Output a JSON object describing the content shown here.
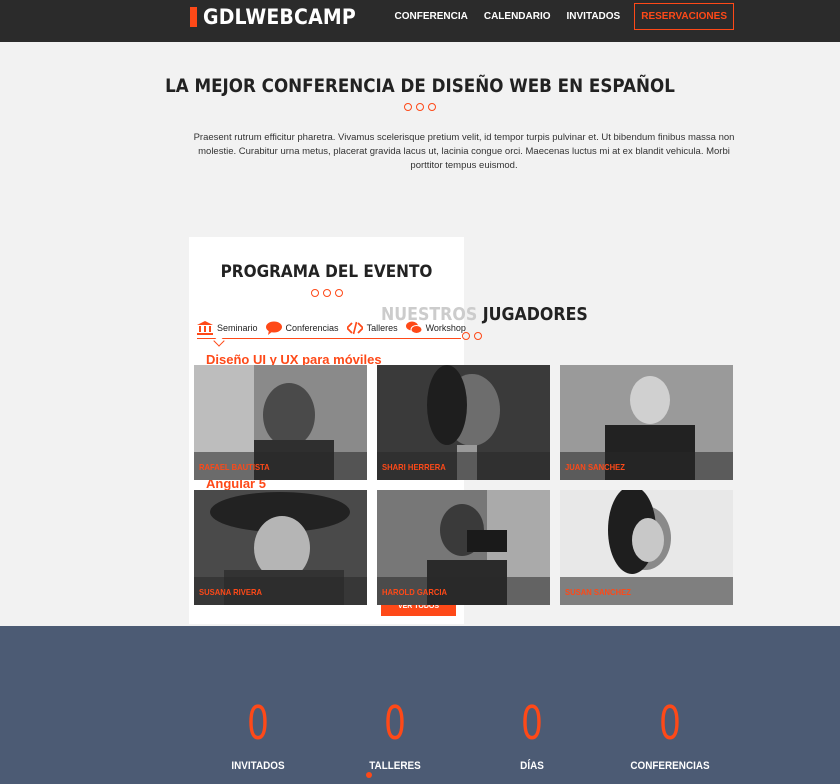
{
  "header": {
    "logo": "GDLWEBCAMP",
    "nav": [
      "CONFERENCIA",
      "CALENDARIO",
      "INVITADOS"
    ],
    "cta": "RESERVACIONES"
  },
  "intro": {
    "title": "LA MEJOR CONFERENCIA DE DISEÑO WEB EN ESPAÑOL",
    "text": "Praesent rutrum efficitur pharetra. Vivamus scelerisque pretium velit, id tempor turpis pulvinar et. Ut bibendum finibus massa non molestie. Curabitur urna metus, placerat gravida lacus ut, lacinia congue orci. Maecenas luctus mi at ex blandit vehicula. Morbi porttitor tempus euismod."
  },
  "program": {
    "title": "PROGRAMA DEL EVENTO",
    "tabs": [
      "Seminario",
      "Conferencias",
      "Talleres",
      "Workshop"
    ],
    "events": [
      "Diseño UI y UX para móviles",
      "Angular 5"
    ],
    "button": "VER TODOS"
  },
  "players": {
    "title_ghost": "NUESTROS",
    "title_rest": " JUGADORES",
    "names": [
      "RAFAEL BAUTISTA",
      "SHARI HERRERA",
      "JUAN SANCHEZ",
      "SUSANA RIVERA",
      "HAROLD GARCIA",
      "SUSAN SANCHEZ"
    ]
  },
  "stats": {
    "items": [
      {
        "value": "0",
        "label": "INVITADOS"
      },
      {
        "value": "0",
        "label": "TALLERES"
      },
      {
        "value": "0",
        "label": "DÍAS"
      },
      {
        "value": "0",
        "label": "CONFERENCIAS"
      }
    ]
  },
  "colors": {
    "accent": "#fe4918",
    "dark": "#2b2b2b",
    "stats_bg": "#4c5b74"
  }
}
